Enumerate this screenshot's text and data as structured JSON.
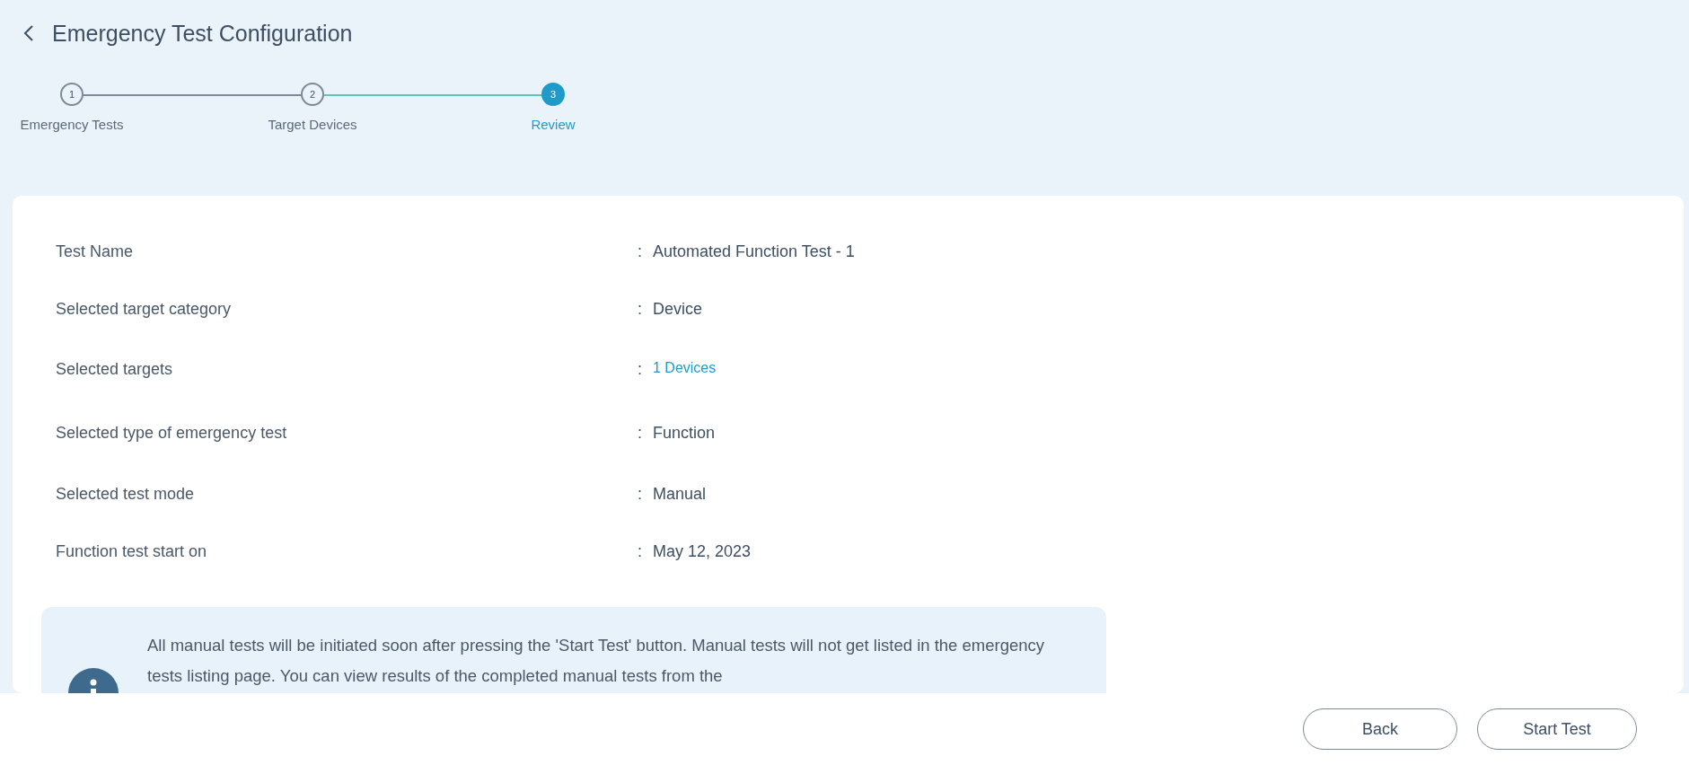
{
  "header": {
    "title": "Emergency Test Configuration"
  },
  "steps": [
    {
      "number": "1",
      "label": "Emergency Tests",
      "selected": false
    },
    {
      "number": "2",
      "label": "Target Devices",
      "selected": false
    },
    {
      "number": "3",
      "label": "Review",
      "selected": true
    }
  ],
  "review": [
    {
      "label": "Test Name",
      "separator": ":",
      "value": "Automated Function Test - 1",
      "kind": "text"
    },
    {
      "label": "Selected target category",
      "separator": ":",
      "value": "Device",
      "kind": "text"
    },
    {
      "label": "Selected targets",
      "separator": ":",
      "value": "1 Devices",
      "kind": "link"
    },
    {
      "label": "Selected type of emergency test",
      "separator": ":",
      "value": "Function",
      "kind": "text"
    },
    {
      "label": "Selected test mode",
      "separator": ":",
      "value": "Manual",
      "kind": "text"
    },
    {
      "label": "Function test start on",
      "separator": ":",
      "value": "May 12, 2023",
      "kind": "text"
    }
  ],
  "info": {
    "text": "All manual tests will be initiated soon after pressing the 'Start Test' button. Manual tests will not get listed in the emergency tests listing page. You can view results of the completed manual tests from the"
  },
  "buttons": [
    "Back",
    "Start Test"
  ]
}
